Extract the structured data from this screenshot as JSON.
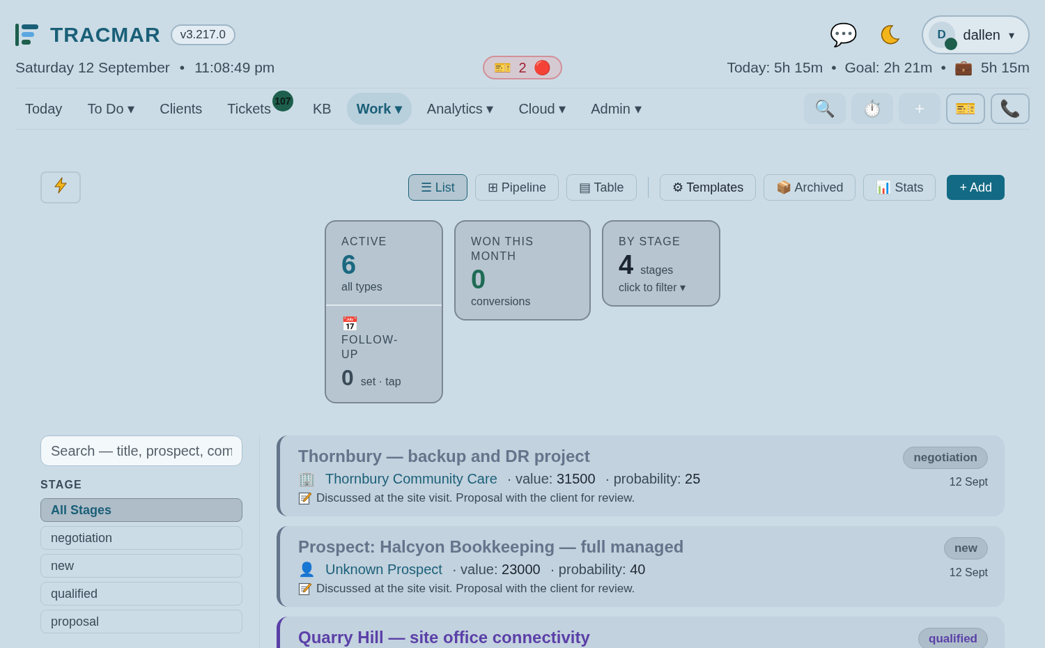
{
  "header": {
    "brand": "TRACMAR",
    "version": "v3.217.0",
    "date": "Saturday 12 September",
    "time": "11:08:49 pm",
    "separator": "•",
    "ticket_alert": {
      "icon": "🎫",
      "count": "2",
      "dot": "🔴"
    },
    "chat_icon": "💬",
    "user": {
      "initial": "D",
      "name": "dallen",
      "caret": "▾",
      "online": true
    },
    "stats": [
      {
        "text": "Today: 5h 15m"
      },
      {
        "text": "Goal: 2h 21m"
      },
      {
        "icon": "💼",
        "text": "5h 15m"
      }
    ]
  },
  "nav": {
    "items": [
      {
        "label": "Today",
        "selected": false
      },
      {
        "label": "To Do",
        "caret": "▾",
        "selected": false
      },
      {
        "label": "Clients",
        "selected": false
      },
      {
        "label": "Tickets",
        "badge": "107",
        "selected": false
      },
      {
        "label": "KB",
        "selected": false
      },
      {
        "label": "Work",
        "caret": "▾",
        "selected": true
      },
      {
        "label": "Analytics",
        "caret": "▾",
        "selected": false
      },
      {
        "label": "Cloud",
        "caret": "▾",
        "selected": false
      },
      {
        "label": "Admin",
        "caret": "▾",
        "selected": false
      }
    ],
    "tools": [
      {
        "icon": "🔍",
        "kind": "plain"
      },
      {
        "icon": "⏱️",
        "kind": "plain"
      },
      {
        "icon": "+",
        "kind": "plain"
      },
      {
        "icon": "🎫",
        "kind": "outlined"
      },
      {
        "icon": "📞",
        "kind": "outlined"
      }
    ]
  },
  "toolbar": {
    "views": [
      {
        "icon": "☰",
        "label": "List",
        "selected": true
      },
      {
        "icon": "⊞",
        "label": "Pipeline",
        "selected": false
      },
      {
        "icon": "▤",
        "label": "Table",
        "selected": false
      }
    ],
    "actions": [
      {
        "icon": "⚙",
        "label": "Templates"
      },
      {
        "icon": "📦",
        "label": "Archived"
      },
      {
        "icon": "📊",
        "label": "Stats"
      }
    ],
    "add": "+ Add"
  },
  "stat_cards": [
    {
      "kind": "split",
      "label": "ACTIVE",
      "value": "6",
      "sub": "all types",
      "color": "#1a6880",
      "lower": {
        "icon": "📅",
        "label": "FOLLOW-UP",
        "value": "0",
        "sub": "set · tap"
      }
    },
    {
      "kind": "simple",
      "label": "WON THIS MONTH",
      "value": "0",
      "sub": "conversions",
      "color": "#1f6b55"
    },
    {
      "kind": "filter",
      "label": "BY STAGE",
      "value": "4",
      "unit": "stages",
      "sub": "click to filter ▾",
      "color": "#1c2530"
    }
  ],
  "sidebar": {
    "search_placeholder": "Search — title, prospect, com",
    "heading": "STAGE",
    "stages": [
      {
        "label": "All Stages",
        "selected": true
      },
      {
        "label": "negotiation",
        "selected": false
      },
      {
        "label": "new",
        "selected": false
      },
      {
        "label": "qualified",
        "selected": false
      },
      {
        "label": "proposal",
        "selected": false
      }
    ]
  },
  "deals": [
    {
      "title": "Thornbury — backup and DR project",
      "stage": "negotiation",
      "date": "12 Sept",
      "client_icon": "🏢",
      "client": "Thornbury Community Care",
      "value_label": "· value:",
      "value": "31500",
      "probability_label": "· probability:",
      "probability": "25",
      "note": "Discussed at the site visit. Proposal with the client for review.",
      "color": "#64748b"
    },
    {
      "title": "Prospect: Halcyon Bookkeeping — full managed",
      "stage": "new",
      "date": "12 Sept",
      "client_icon": "👤",
      "client": "Unknown Prospect",
      "value_label": "· value:",
      "value": "23000",
      "probability_label": "· probability:",
      "probability": "40",
      "note": "Discussed at the site visit. Proposal with the client for review.",
      "color": "#64748b"
    },
    {
      "title": "Quarry Hill — site office connectivity",
      "stage": "qualified",
      "color": "#5b3fa8"
    }
  ]
}
